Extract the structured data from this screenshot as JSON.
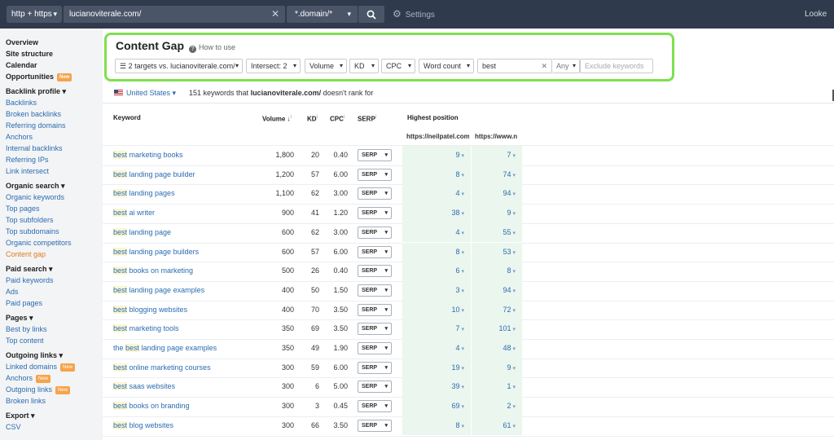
{
  "topbar": {
    "protocol": "http + https",
    "url": "lucianoviterale.com/",
    "mode": "*.domain/*",
    "settings": "Settings",
    "right_text": "Looke"
  },
  "sidebar": {
    "sections": [
      {
        "heading": "Overview",
        "items": []
      },
      {
        "heading": "Site structure",
        "items": []
      },
      {
        "heading": "Calendar",
        "items": []
      },
      {
        "heading": "Opportunities",
        "badge": "New",
        "items": []
      },
      {
        "heading": "Backlink profile ▾",
        "items": [
          {
            "label": "Backlinks"
          },
          {
            "label": "Broken backlinks"
          },
          {
            "label": "Referring domains"
          },
          {
            "label": "Anchors"
          },
          {
            "label": "Internal backlinks"
          },
          {
            "label": "Referring IPs"
          },
          {
            "label": "Link intersect"
          }
        ]
      },
      {
        "heading": "Organic search ▾",
        "items": [
          {
            "label": "Organic keywords"
          },
          {
            "label": "Top pages"
          },
          {
            "label": "Top subfolders"
          },
          {
            "label": "Top subdomains"
          },
          {
            "label": "Organic competitors"
          },
          {
            "label": "Content gap",
            "active": true
          }
        ]
      },
      {
        "heading": "Paid search ▾",
        "items": [
          {
            "label": "Paid keywords"
          },
          {
            "label": "Ads"
          },
          {
            "label": "Paid pages"
          }
        ]
      },
      {
        "heading": "Pages ▾",
        "items": [
          {
            "label": "Best by links"
          },
          {
            "label": "Top content"
          }
        ]
      },
      {
        "heading": "Outgoing links ▾",
        "items": [
          {
            "label": "Linked domains",
            "badge": "New"
          },
          {
            "label": "Anchors",
            "badge": "New"
          },
          {
            "label": "Outgoing links",
            "badge": "New"
          },
          {
            "label": "Broken links"
          }
        ]
      },
      {
        "heading": "Export ▾",
        "items": [
          {
            "label": "CSV"
          }
        ]
      }
    ]
  },
  "content_gap": {
    "title": "Content Gap",
    "how_to": "How to use",
    "filters": {
      "targets": "2 targets vs. lucianoviterale.com/",
      "intersect": "Intersect: 2",
      "volume": "Volume",
      "kd": "KD",
      "cpc": "CPC",
      "word_count": "Word count",
      "search_value": "best",
      "any": "Any",
      "exclude_placeholder": "Exclude keywords"
    }
  },
  "country_bar": {
    "country": "United States",
    "count_text": "151 keywords that",
    "domain": "lucianoviterale.com/",
    "suffix": "doesn't rank for"
  },
  "table": {
    "headers": {
      "keyword": "Keyword",
      "volume": "Volume",
      "kd": "KD",
      "cpc": "CPC",
      "serp": "SERP",
      "highest_position": "Highest position",
      "target1": "https://neilpatel.com",
      "target2": "https://www.n"
    },
    "serp_label": "SERP",
    "rows": [
      {
        "highlight": "best",
        "rest": " marketing books",
        "volume": "1,800",
        "kd": "20",
        "cpc": "0.40",
        "pos1": "9",
        "pos2": "7"
      },
      {
        "highlight": "best",
        "rest": " landing page builder",
        "volume": "1,200",
        "kd": "57",
        "cpc": "6.00",
        "pos1": "8",
        "pos2": "74"
      },
      {
        "highlight": "best",
        "rest": " landing pages",
        "volume": "1,100",
        "kd": "62",
        "cpc": "3.00",
        "pos1": "4",
        "pos2": "94"
      },
      {
        "highlight": "best",
        "rest": " ai writer",
        "volume": "900",
        "kd": "41",
        "cpc": "1.20",
        "pos1": "38",
        "pos2": "9"
      },
      {
        "highlight": "best",
        "rest": " landing page",
        "volume": "600",
        "kd": "62",
        "cpc": "3.00",
        "pos1": "4",
        "pos2": "55"
      },
      {
        "highlight": "best",
        "rest": " landing page builders",
        "volume": "600",
        "kd": "57",
        "cpc": "6.00",
        "pos1": "8",
        "pos2": "53"
      },
      {
        "highlight": "best",
        "rest": " books on marketing",
        "volume": "500",
        "kd": "26",
        "cpc": "0.40",
        "pos1": "6",
        "pos2": "8"
      },
      {
        "highlight": "best",
        "rest": " landing page examples",
        "volume": "400",
        "kd": "50",
        "cpc": "1.50",
        "pos1": "3",
        "pos2": "94"
      },
      {
        "highlight": "best",
        "rest": " blogging websites",
        "volume": "400",
        "kd": "70",
        "cpc": "3.50",
        "pos1": "10",
        "pos2": "72"
      },
      {
        "highlight": "best",
        "rest": " marketing tools",
        "volume": "350",
        "kd": "69",
        "cpc": "3.50",
        "pos1": "7",
        "pos2": "101"
      },
      {
        "prefix": "the ",
        "highlight": "best",
        "rest": " landing page examples",
        "volume": "350",
        "kd": "49",
        "cpc": "1.90",
        "pos1": "4",
        "pos2": "48"
      },
      {
        "highlight": "best",
        "rest": " online marketing courses",
        "volume": "300",
        "kd": "59",
        "cpc": "6.00",
        "pos1": "19",
        "pos2": "9"
      },
      {
        "highlight": "best",
        "rest": " saas websites",
        "volume": "300",
        "kd": "6",
        "cpc": "5.00",
        "pos1": "39",
        "pos2": "1"
      },
      {
        "highlight": "best",
        "rest": " books on branding",
        "volume": "300",
        "kd": "3",
        "cpc": "0.45",
        "pos1": "69",
        "pos2": "2"
      },
      {
        "highlight": "best",
        "rest": " blog websites",
        "volume": "300",
        "kd": "66",
        "cpc": "3.50",
        "pos1": "8",
        "pos2": "61"
      }
    ]
  },
  "colors": {
    "topbar": "#2f3a4c",
    "link": "#2b6cb0",
    "highlight_box": "#7ee04e",
    "active_nav": "#e07b1f",
    "position_bg": "#eaf6ee"
  }
}
